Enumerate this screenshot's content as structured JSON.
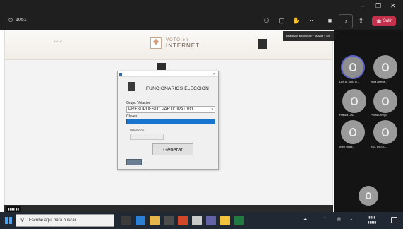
{
  "toolbar": {
    "meeting_time": "1051",
    "leave_label": "Salir",
    "mic_tooltip": "Reactivar audio (Ctrl + Mayús + M)"
  },
  "banner": {
    "center_line1": "VOTO en",
    "center_line2": "INTERNET"
  },
  "dialog": {
    "header_title": "FUNCIONARIOS ELECCIÓN",
    "group_label": "Grupo Votación",
    "group_value": "PRESUPUESTO PARTICIPATIVO",
    "key_label": "Claves",
    "validation_label": "Validación",
    "generate_button": "Generar"
  },
  "participants": [
    {
      "name": "Luis A. Sanz R..."
    },
    {
      "name": "erika alteme..."
    },
    {
      "name": "Priscila Lóv..."
    },
    {
      "name": "Pedro Urrego"
    },
    {
      "name": "Aylin Urqui..."
    },
    {
      "name": "ING. DIEGO..."
    }
  ],
  "taskbar": {
    "search_placeholder": "Escribe aquí para buscar"
  },
  "colors": {
    "teams_dark": "#1f1f1f",
    "leave_red": "#c4314b",
    "selection_blue": "#1874cd",
    "taskbar": "#202833"
  },
  "icons": [
    "clock-icon",
    "chat-icon",
    "raise-hand-icon",
    "more-icon",
    "camera-icon",
    "mic-off-icon",
    "share-icon",
    "phone-icon",
    "search-icon",
    "windows-start-icon"
  ]
}
